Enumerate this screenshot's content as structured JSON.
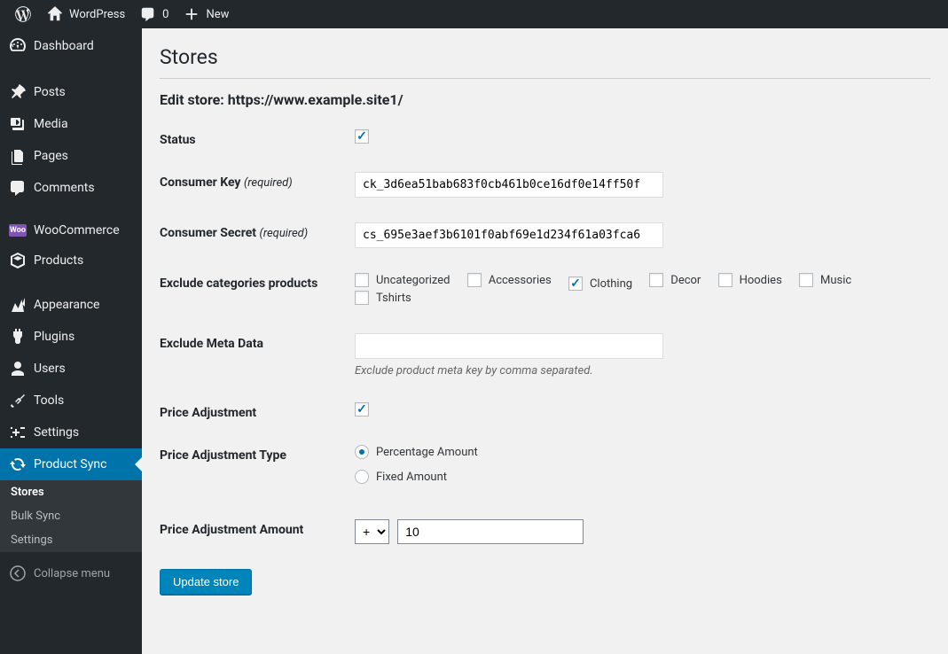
{
  "adminbar": {
    "site_name": "WordPress",
    "comments_count": "0",
    "new_label": "New"
  },
  "sidebar": {
    "items": [
      {
        "label": "Dashboard"
      },
      {
        "label": "Posts"
      },
      {
        "label": "Media"
      },
      {
        "label": "Pages"
      },
      {
        "label": "Comments"
      },
      {
        "label": "WooCommerce"
      },
      {
        "label": "Products"
      },
      {
        "label": "Appearance"
      },
      {
        "label": "Plugins"
      },
      {
        "label": "Users"
      },
      {
        "label": "Tools"
      },
      {
        "label": "Settings"
      },
      {
        "label": "Product Sync"
      }
    ],
    "submenu": [
      {
        "label": "Stores"
      },
      {
        "label": "Bulk Sync"
      },
      {
        "label": "Settings"
      }
    ],
    "collapse_label": "Collapse menu"
  },
  "page": {
    "title": "Stores",
    "subtitle": "Edit store: https://www.example.site1/"
  },
  "form": {
    "status": {
      "label": "Status",
      "checked": true
    },
    "consumer_key": {
      "label": "Consumer Key",
      "required": "(required)",
      "value": "ck_3d6ea51bab683f0cb461b0ce16df0e14ff50f"
    },
    "consumer_secret": {
      "label": "Consumer Secret",
      "required": "(required)",
      "value": "cs_695e3aef3b6101f0abf69e1d234f61a03fca6"
    },
    "exclude_cats": {
      "label": "Exclude categories products",
      "options": [
        {
          "label": "Uncategorized",
          "checked": false
        },
        {
          "label": "Accessories",
          "checked": false
        },
        {
          "label": "Clothing",
          "checked": true
        },
        {
          "label": "Decor",
          "checked": false
        },
        {
          "label": "Hoodies",
          "checked": false
        },
        {
          "label": "Music",
          "checked": false
        },
        {
          "label": "Tshirts",
          "checked": false
        }
      ]
    },
    "exclude_meta": {
      "label": "Exclude Meta Data",
      "value": "",
      "desc": "Exclude product meta key by comma separated."
    },
    "price_adjust": {
      "label": "Price Adjustment",
      "checked": true
    },
    "price_type": {
      "label": "Price Adjustment Type",
      "options": [
        {
          "label": "Percentage Amount",
          "checked": true
        },
        {
          "label": "Fixed Amount",
          "checked": false
        }
      ]
    },
    "price_amount": {
      "label": "Price Adjustment Amount",
      "select_value": "+",
      "value": "10"
    },
    "submit": "Update store"
  }
}
